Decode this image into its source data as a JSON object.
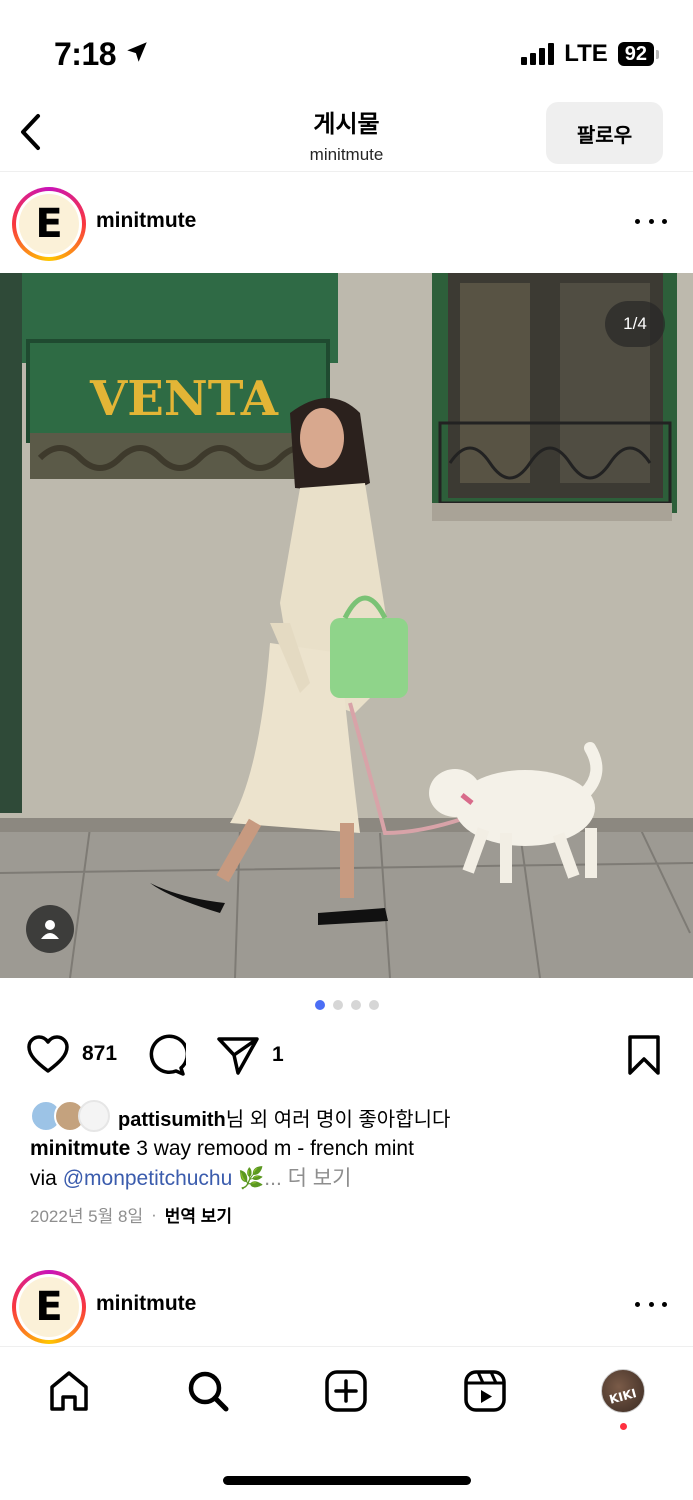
{
  "status_bar": {
    "time": "7:18",
    "network": "LTE",
    "battery": "92"
  },
  "header": {
    "title": "게시물",
    "subtitle": "minitmute",
    "follow_label": "팔로우"
  },
  "post": {
    "username": "minitmute",
    "avatar_letter": "E",
    "image_counter": "1/4",
    "carousel": {
      "total": 4,
      "active": 1
    },
    "sign_text": "VENTA",
    "actions": {
      "like_count": "871",
      "share_count": "1"
    },
    "likes": {
      "user": "pattisumith",
      "suffix": "님 외 여러 명이 좋아합니다"
    },
    "caption": {
      "username": "minitmute",
      "text": "3 way remood m - french mint",
      "line2_prefix": "via",
      "mention": "@monpetitchuchu",
      "emoji": "🌿",
      "more": "... 더 보기"
    },
    "date": "2022년 5월 8일",
    "separator": "·",
    "translate": "번역 보기"
  },
  "next_post": {
    "username": "minitmute",
    "avatar_letter": "E"
  },
  "bottom_nav": {
    "profile_text": "KIKI"
  },
  "colors": {
    "accent": "#3b5cad",
    "dot_active": "#4b6ef5",
    "follow_bg": "#efefef",
    "notification": "#ff3040"
  }
}
